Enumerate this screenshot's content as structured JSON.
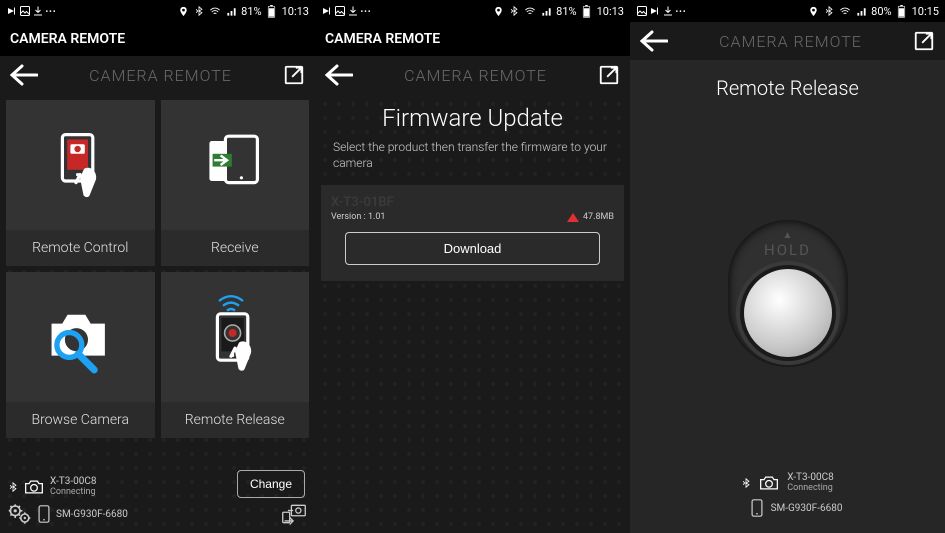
{
  "status": {
    "battery1": "81%",
    "time1": "10:13",
    "battery2": "81%",
    "time2": "10:13",
    "battery3": "80%",
    "time3": "10:15"
  },
  "app_title": "CAMERA REMOTE",
  "nav_title": "CAMERA REMOTE",
  "screen1": {
    "tiles": {
      "remote_control": "Remote Control",
      "receive": "Receive",
      "browse_camera": "Browse Camera",
      "remote_release": "Remote Release"
    },
    "camera_name": "X-T3-00C8",
    "camera_status": "Connecting",
    "phone_name": "SM-G930F-6680",
    "change_btn": "Change"
  },
  "screen2": {
    "title": "Firmware Update",
    "subtitle": "Select the product then transfer the firmware to your camera",
    "product": "X-T3-01BF",
    "version_label": "Version : 1.01",
    "size": "47.8MB",
    "download_btn": "Download"
  },
  "screen3": {
    "title": "Remote Release",
    "hold_label": "HOLD",
    "camera_name": "X-T3-00C8",
    "camera_status": "Connecting",
    "phone_name": "SM-G930F-6680"
  }
}
